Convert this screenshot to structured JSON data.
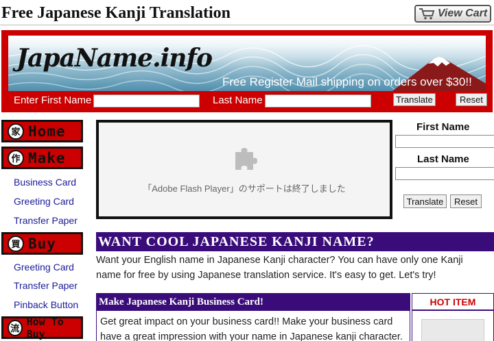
{
  "header": {
    "title": "Free Japanese Kanji Translation",
    "view_cart_label": "View Cart"
  },
  "banner": {
    "logo": "JapaName.info",
    "promo": "Free Register Mail shipping on orders over $30!!",
    "first_name_label": "Enter First Name",
    "first_name_value": "",
    "last_name_label": "Last Name",
    "last_name_value": "",
    "translate_label": "Translate",
    "reset_label": "Reset"
  },
  "nav": {
    "home": {
      "kanji": "家",
      "label": "Home"
    },
    "make": {
      "kanji": "作",
      "label": "Make"
    },
    "make_links": [
      "Business Card",
      "Greeting Card",
      "Transfer Paper"
    ],
    "buy": {
      "kanji": "買",
      "label": "Buy"
    },
    "buy_links": [
      "Greeting Card",
      "Transfer Paper",
      "Pinback Button"
    ],
    "howto": {
      "kanji": "流",
      "label": "How To Buy"
    }
  },
  "flash": {
    "message": "「Adobe Flash Player」のサポートは終了しました"
  },
  "side_form": {
    "first_name_label": "First Name",
    "last_name_label": "Last Name",
    "translate_label": "Translate",
    "reset_label": "Reset"
  },
  "main": {
    "want_heading": "WANT COOL JAPANESE KANJI NAME?",
    "want_line1": "Want your English name in Japanese Kanji character? You can have only one Kanji",
    "want_line2": "name for free by using Japanese translation service. It's easy to get. Let's try!",
    "biz_heading": "Make Japanese Kanji Business Card!",
    "biz_line1": "Get great impact on your business card!! Make your business card",
    "biz_line2": "have a great impression with your name in Japanese kanji character.",
    "hot_item_label": "HOT ITEM"
  },
  "colors": {
    "brand_red": "#cc0000",
    "heading_purple": "#3a0c7a",
    "link_blue": "#1a1a99"
  }
}
